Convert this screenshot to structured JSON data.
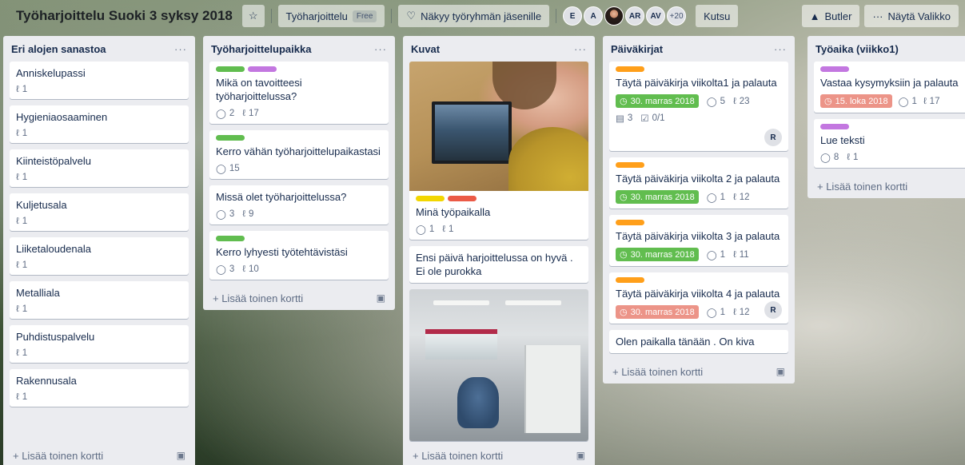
{
  "header": {
    "title": "Työharjoittelu Suoki 3 syksy 2018",
    "team": "Työharjoittelu",
    "team_badge": "Free",
    "visibility": "Näkyy työryhmän jäsenille",
    "members": [
      "E",
      "A",
      "AR",
      "AV"
    ],
    "more_members": "+20",
    "invite": "Kutsu",
    "butler": "Butler",
    "show_menu": "Näytä Valikko"
  },
  "colors": {
    "green": "#61bd4f",
    "purple": "#c377e0",
    "orange": "#ff9f1a",
    "yellow": "#f2d600",
    "red": "#eb5a46",
    "due_green": "#61bd4f",
    "due_red": "#ec9488"
  },
  "lists": [
    {
      "title": "Eri alojen sanastoa",
      "add_card": "+ Lisää toinen kortti",
      "cards": [
        {
          "title": "Anniskelupassi",
          "attachments": "1"
        },
        {
          "title": "Hygieniaosaaminen",
          "attachments": "1"
        },
        {
          "title": "Kiinteistöpalvelu",
          "attachments": "1"
        },
        {
          "title": "Kuljetusala",
          "attachments": "1"
        },
        {
          "title": "Liiketaloudenala",
          "attachments": "1"
        },
        {
          "title": "Metalliala",
          "attachments": "1"
        },
        {
          "title": "Puhdistuspalvelu",
          "attachments": "1"
        },
        {
          "title": "Rakennusala",
          "attachments": "1"
        }
      ]
    },
    {
      "title": "Työharjoittelupaikka",
      "add_card": "+ Lisää toinen kortti",
      "cards": [
        {
          "title": "Mikä on tavoitteesi työharjoittelussa?",
          "comments": "2",
          "attachments": "17"
        },
        {
          "title": "Kerro vähän työharjoittelupaikastasi",
          "comments": "15"
        },
        {
          "title": "Missä olet työharjoittelussa?",
          "comments": "3",
          "attachments": "9"
        },
        {
          "title": "Kerro lyhyesti työtehtävistäsi",
          "comments": "3",
          "attachments": "10"
        }
      ]
    },
    {
      "title": "Kuvat",
      "add_card": "+ Lisää toinen kortti",
      "cards": [
        {
          "title": "Minä työpaikalla",
          "comments": "1",
          "attachments": "1"
        },
        {
          "title": "Ensi päivä harjoittelussa on hyvä . Ei ole purokka"
        }
      ]
    },
    {
      "title": "Päiväkirjat",
      "add_card": "+ Lisää toinen kortti",
      "cards": [
        {
          "title": "Täytä päiväkirja viikolta1 ja palauta",
          "due": "30. marras 2018",
          "comments": "5",
          "attachments": "23",
          "description": "3",
          "checklist": "0/1",
          "member": "R"
        },
        {
          "title": "Täytä päiväkirja viikolta 2 ja palauta",
          "due": "30. marras 2018",
          "comments": "1",
          "attachments": "12"
        },
        {
          "title": "Täytä päiväkirja viikolta 3 ja palauta",
          "due": "30. marras 2018",
          "comments": "1",
          "attachments": "11"
        },
        {
          "title": "Täytä päiväkirja viikolta 4 ja palauta",
          "due": "30. marras 2018",
          "comments": "1",
          "attachments": "12",
          "member": "R"
        },
        {
          "title": "Olen paikalla tänään . On kiva"
        }
      ]
    },
    {
      "title": "Työaika (viikko1)",
      "add_card": "+ Lisää toinen kortti",
      "cards": [
        {
          "title": "Vastaa kysymyksiin ja palauta",
          "due": "15. loka 2018",
          "comments": "1",
          "attachments": "17"
        },
        {
          "title": "Lue teksti",
          "comments": "8",
          "attachments": "1"
        }
      ]
    }
  ]
}
